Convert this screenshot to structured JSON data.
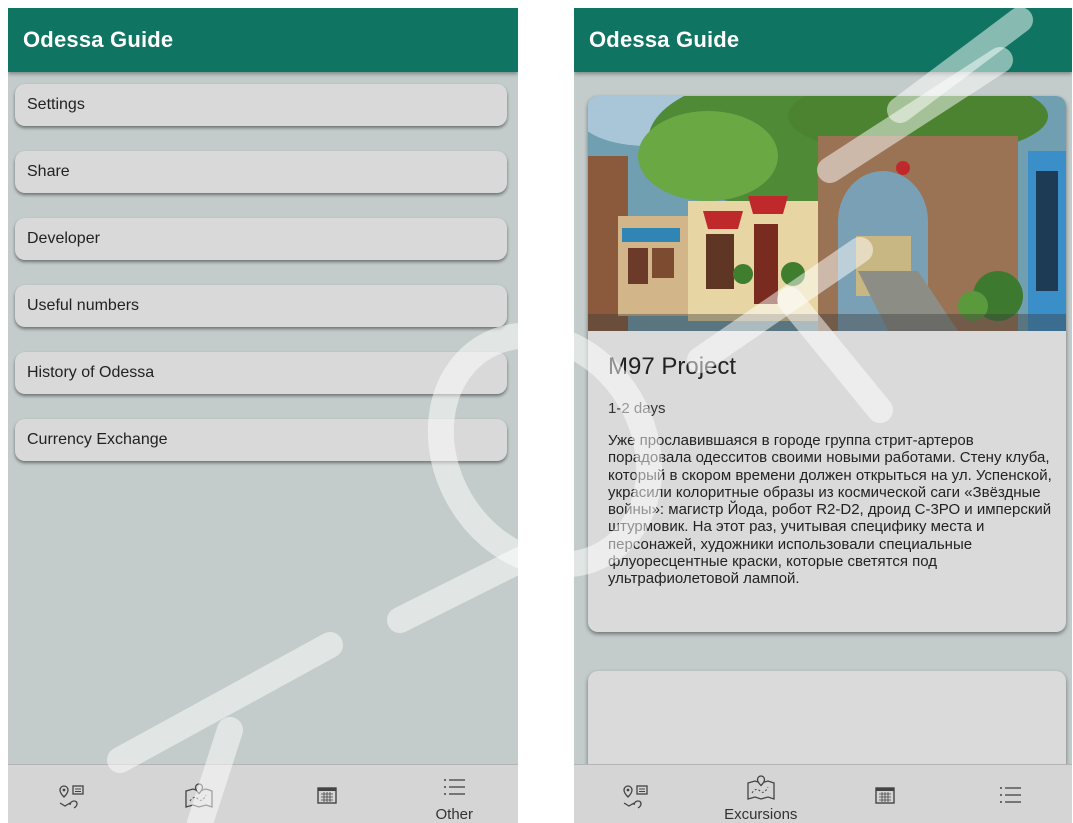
{
  "left_screen": {
    "app_title": "Odessa Guide",
    "menu_items": [
      {
        "label": "Settings"
      },
      {
        "label": "Share"
      },
      {
        "label": "Developer"
      },
      {
        "label": "Useful numbers"
      },
      {
        "label": "History of Odessa"
      },
      {
        "label": "Currency Exchange"
      }
    ],
    "bottom_nav": [
      {
        "icon": "places-icon",
        "label": ""
      },
      {
        "icon": "map-icon",
        "label": ""
      },
      {
        "icon": "calendar-icon",
        "label": ""
      },
      {
        "icon": "list-icon",
        "label": "Other",
        "active": true
      }
    ]
  },
  "right_screen": {
    "app_title": "Odessa Guide",
    "card": {
      "image": "street-art-mural",
      "title": "M97 Project",
      "duration": "1-2 days",
      "description": "Уже прославившаяся в городе группа стрит-артеров порадовала одесситов своими новыми работами. Стену клуба, который в  скором времени должен открыться на ул. Успенской, украсили колоритные образы из космической саги «Звёздные войны»: магистр Йода, робот R2-D2, дроид С-3РО и имперский штурмовик.  На этот раз, учитывая специфику места и персонажей, художники использовали специальные флуоресцентные краски, которые светятся под ультрафиолетовой лампой."
    },
    "bottom_nav": [
      {
        "icon": "places-icon",
        "label": ""
      },
      {
        "icon": "map-icon",
        "label": "Excursions",
        "active": true
      },
      {
        "icon": "calendar-icon",
        "label": ""
      },
      {
        "icon": "list-icon",
        "label": ""
      }
    ]
  },
  "colors": {
    "app_bar": "#0f7461",
    "background": "#c3cccb",
    "card": "#dadada",
    "bottom_nav": "#d5d5d5"
  }
}
